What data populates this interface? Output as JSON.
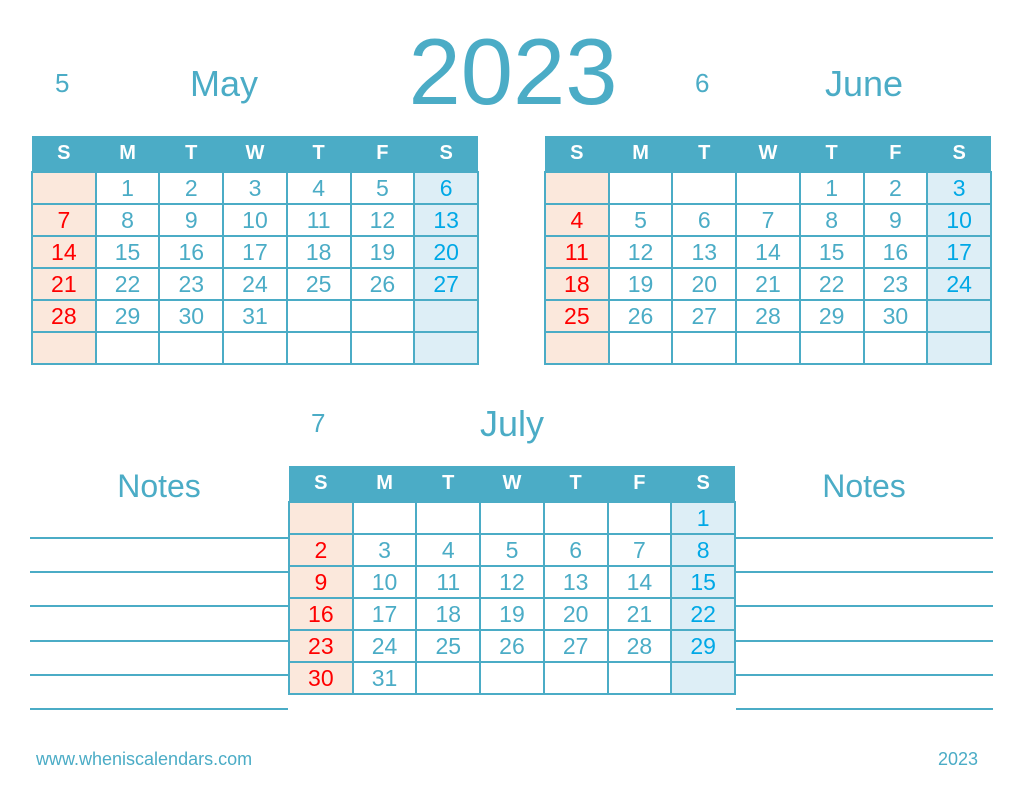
{
  "year": "2023",
  "weekdays": [
    "S",
    "M",
    "T",
    "W",
    "T",
    "F",
    "S"
  ],
  "months": [
    {
      "number": "5",
      "name": "May",
      "weeks": [
        [
          "",
          "1",
          "2",
          "3",
          "4",
          "5",
          "6"
        ],
        [
          "7",
          "8",
          "9",
          "10",
          "11",
          "12",
          "13"
        ],
        [
          "14",
          "15",
          "16",
          "17",
          "18",
          "19",
          "20"
        ],
        [
          "21",
          "22",
          "23",
          "24",
          "25",
          "26",
          "27"
        ],
        [
          "28",
          "29",
          "30",
          "31",
          "",
          "",
          ""
        ],
        [
          "",
          "",
          "",
          "",
          "",
          "",
          ""
        ]
      ]
    },
    {
      "number": "6",
      "name": "June",
      "weeks": [
        [
          "",
          "",
          "",
          "",
          "1",
          "2",
          "3"
        ],
        [
          "4",
          "5",
          "6",
          "7",
          "8",
          "9",
          "10"
        ],
        [
          "11",
          "12",
          "13",
          "14",
          "15",
          "16",
          "17"
        ],
        [
          "18",
          "19",
          "20",
          "21",
          "22",
          "23",
          "24"
        ],
        [
          "25",
          "26",
          "27",
          "28",
          "29",
          "30",
          ""
        ],
        [
          "",
          "",
          "",
          "",
          "",
          "",
          ""
        ]
      ]
    },
    {
      "number": "7",
      "name": "July",
      "weeks": [
        [
          "",
          "",
          "",
          "",
          "",
          "",
          "1"
        ],
        [
          "2",
          "3",
          "4",
          "5",
          "6",
          "7",
          "8"
        ],
        [
          "9",
          "10",
          "11",
          "12",
          "13",
          "14",
          "15"
        ],
        [
          "16",
          "17",
          "18",
          "19",
          "20",
          "21",
          "22"
        ],
        [
          "23",
          "24",
          "25",
          "26",
          "27",
          "28",
          "29"
        ],
        [
          "30",
          "31",
          "",
          "",
          "",
          "",
          ""
        ]
      ]
    }
  ],
  "notes": {
    "left_title": "Notes",
    "right_title": "Notes",
    "line_count": 6
  },
  "footer": {
    "website": "www.wheniscalendars.com",
    "year": "2023"
  },
  "colors": {
    "accent": "#4bacc6",
    "sunday": "#ff0000",
    "saturday": "#00a8e6",
    "sunday_bg": "#fbe8dc",
    "saturday_bg": "#ddeef6"
  }
}
